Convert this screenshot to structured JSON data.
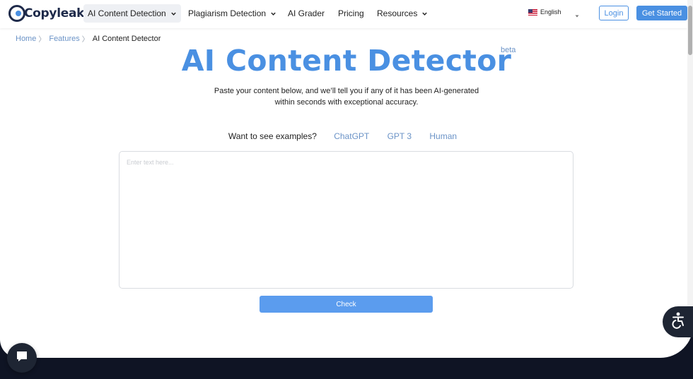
{
  "brand": {
    "name": "Copyleaks"
  },
  "nav": {
    "items": [
      {
        "label": "AI Content Detection",
        "has_dropdown": true,
        "active": true
      },
      {
        "label": "Plagiarism Detection",
        "has_dropdown": true,
        "active": false
      },
      {
        "label": "AI Grader",
        "has_dropdown": false,
        "active": false
      },
      {
        "label": "Pricing",
        "has_dropdown": false,
        "active": false
      },
      {
        "label": "Resources",
        "has_dropdown": true,
        "active": false
      }
    ],
    "language": "English",
    "login_label": "Login",
    "get_started_label": "Get Started"
  },
  "breadcrumb": {
    "items": [
      "Home",
      "Features"
    ],
    "separator": "〉",
    "current": "AI Content Detector"
  },
  "hero": {
    "title": "AI Content Detector",
    "badge": "beta",
    "subtitle_line1": "Paste your content below, and we’ll tell you if any of it has been AI-generated",
    "subtitle_line2": "within seconds with exceptional accuracy."
  },
  "examples": {
    "label": "Want to see examples?",
    "links": [
      "ChatGPT",
      "GPT 3",
      "Human"
    ]
  },
  "editor": {
    "placeholder": "Enter text here...",
    "value": ""
  },
  "check_button": {
    "label": "Check"
  },
  "colors": {
    "accent": "#4a90e2",
    "button": "#5b9cee",
    "link": "#6b93c7",
    "footer": "#0f1424",
    "widget": "#1e2533"
  },
  "icons": {
    "accessibility": "accessibility-icon",
    "chat": "chat-icon",
    "flag": "us-flag-icon"
  }
}
